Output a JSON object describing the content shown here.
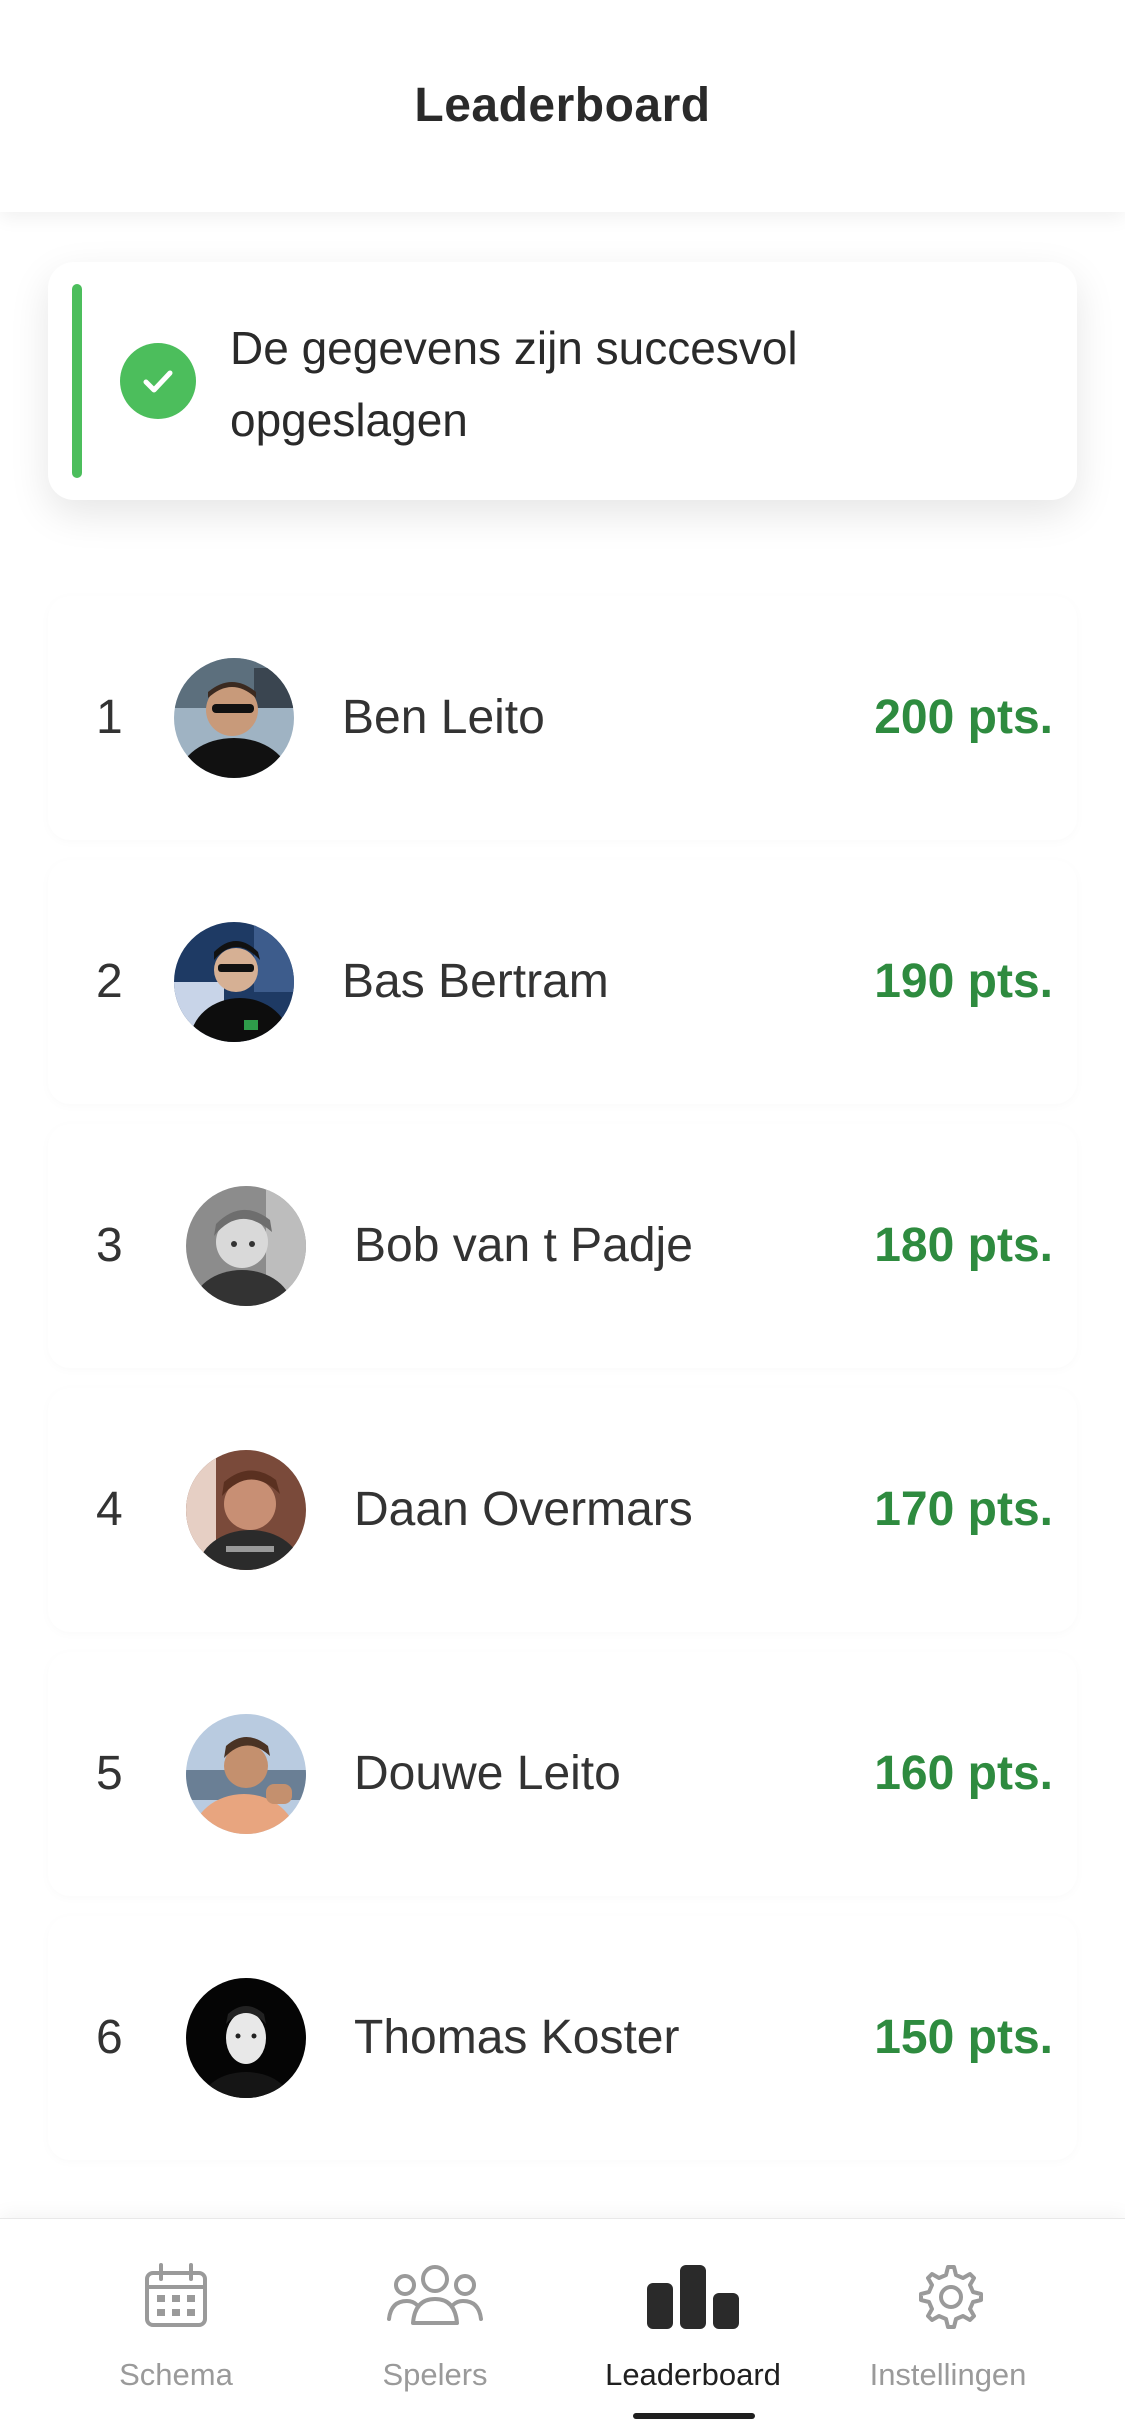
{
  "header": {
    "title": "Leaderboard"
  },
  "toast": {
    "message": "De gegevens zijn succesvol opgeslagen",
    "accent": "#4cbe5c"
  },
  "leaderboard": [
    {
      "rank": "1",
      "name": "Ben Leito",
      "points": "200 pts."
    },
    {
      "rank": "2",
      "name": "Bas Bertram",
      "points": "190 pts."
    },
    {
      "rank": "3",
      "name": "Bob van t Padje",
      "points": "180 pts."
    },
    {
      "rank": "4",
      "name": "Daan Overmars",
      "points": "170 pts."
    },
    {
      "rank": "5",
      "name": "Douwe Leito",
      "points": "160 pts."
    },
    {
      "rank": "6",
      "name": "Thomas Koster",
      "points": "150 pts."
    }
  ],
  "tabs": [
    {
      "label": "Schema",
      "icon": "calendar-icon"
    },
    {
      "label": "Spelers",
      "icon": "users-icon"
    },
    {
      "label": "Leaderboard",
      "icon": "bar-chart-icon",
      "active": true
    },
    {
      "label": "Instellingen",
      "icon": "gear-icon"
    }
  ],
  "colors": {
    "points": "#2e8b3f",
    "success": "#4cbe5c"
  }
}
